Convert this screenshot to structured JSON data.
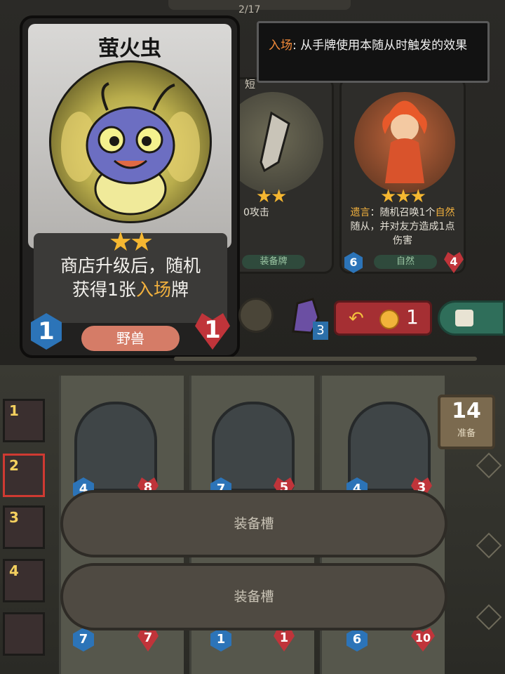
{
  "header": {
    "page_indicator": "2/17"
  },
  "main_card": {
    "name": "萤火虫",
    "stars": "★★",
    "description_line1": "商店升级后，随机",
    "description_prefix": "获得1张",
    "description_highlight": "入场",
    "description_suffix": "牌",
    "tribe": "野兽",
    "attack": "1",
    "health": "1"
  },
  "tooltip": {
    "keyword": "入场",
    "text": ": 从手牌使用本随从时触发的效果"
  },
  "shop": {
    "cards": [
      {
        "desc_partial": "0攻击",
        "tag": "装备牌",
        "stars": "★★",
        "title_partial": "短"
      },
      {
        "stars": "★★★",
        "desc_kw1": "遗言",
        "desc_p1": "：随机召唤1个",
        "desc_kw2": "自然",
        "desc_p2": "随从，并对友方造成1点伤害",
        "tag": "自然",
        "attack": "6",
        "health": "4"
      }
    ]
  },
  "controls": {
    "potion_count": "3",
    "refresh_cost": "1"
  },
  "roster": {
    "slots": [
      {
        "num": "1"
      },
      {
        "num": "2"
      },
      {
        "num": "3"
      },
      {
        "num": "4"
      },
      {
        "num": ""
      }
    ],
    "active_index": 1
  },
  "board": {
    "minions": [
      {
        "attack": "4",
        "health": "8"
      },
      {
        "attack": "7",
        "health": "5"
      },
      {
        "attack": "4",
        "health": "3"
      }
    ],
    "bottom_stats": [
      {
        "attack": "7",
        "health": "7"
      },
      {
        "attack": "1",
        "health": "1"
      },
      {
        "attack": "6",
        "health": "10"
      }
    ],
    "ready_count": "14",
    "ready_label": "准备"
  },
  "equipment": {
    "slot1_label": "装备槽",
    "slot2_label": "装备槽"
  },
  "colors": {
    "gold_star": "#f5b731",
    "keyword_highlight": "#f2b13e",
    "tribe_tag": "#d57c67",
    "refresh_button": "#a52f33",
    "lock_button": "#2f6e5a"
  }
}
